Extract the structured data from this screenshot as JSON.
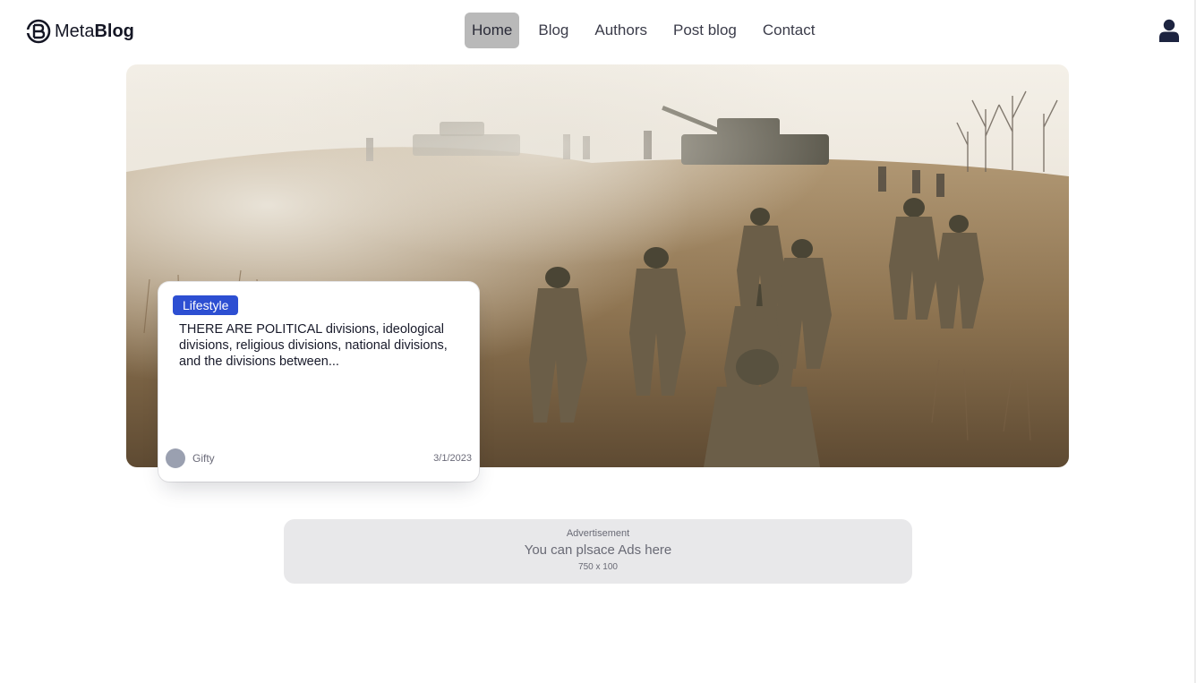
{
  "header": {
    "logo": {
      "prefix": "Meta",
      "bold": "Blog",
      "icon": "metablog-logo-icon"
    },
    "nav": [
      {
        "label": "Home",
        "active": true
      },
      {
        "label": "Blog",
        "active": false
      },
      {
        "label": "Authors",
        "active": false
      },
      {
        "label": "Post blog",
        "active": false
      },
      {
        "label": "Contact",
        "active": false
      }
    ],
    "user_icon": "user-icon"
  },
  "hero": {
    "image": "soldiers-and-tanks-advancing-across-smoky-field",
    "card": {
      "category": "Lifestyle",
      "title": "THERE ARE POLITICAL divisions, ideological divisions, religious divisions, national divisions, and the divisions between...",
      "author": "Gifty",
      "date": "3/1/2023"
    }
  },
  "ad": {
    "label": "Advertisement",
    "text": "You can plsace Ads here",
    "size": "750 x 100"
  },
  "colors": {
    "accent": "#2d4fd2",
    "nav_active_bg": "#b9b9b9",
    "ad_bg": "#e8e8ea",
    "text_dark": "#181a2a"
  }
}
